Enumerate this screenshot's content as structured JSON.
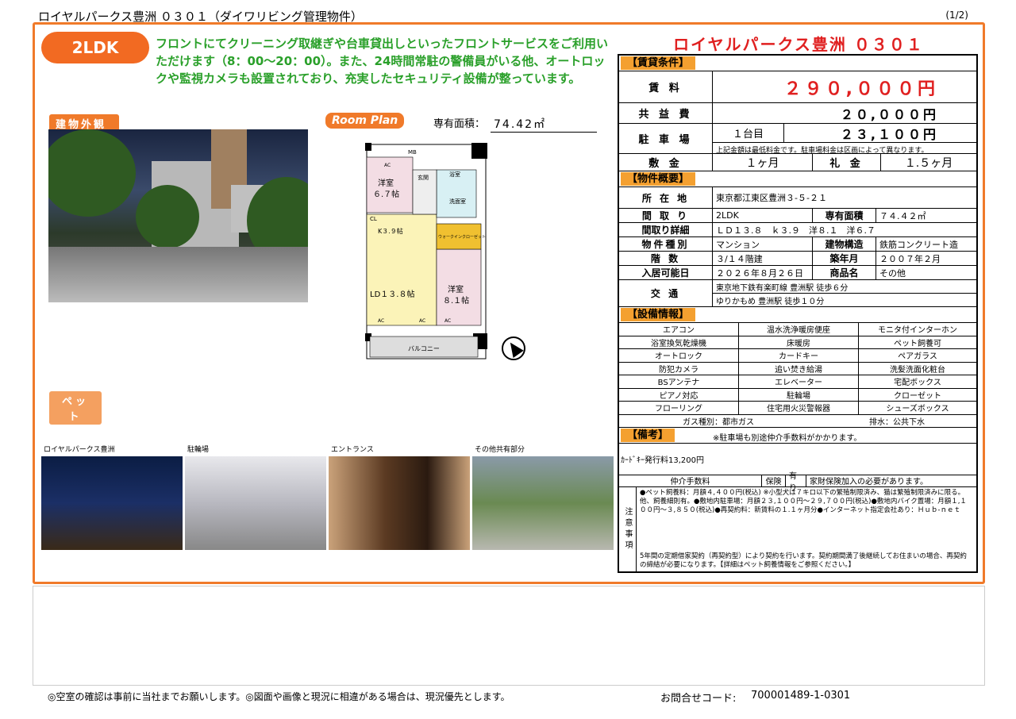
{
  "header": {
    "title": "ロイヤルパークス豊洲 ０３０１（ダイワリビング管理物件）",
    "page": "(1/2)"
  },
  "badge": "2LDK",
  "catchcopy": "フロントにてクリーニング取継ぎや台車貸出しといったフロントサービスをご利用いただけます（8：00〜20：00）。また、24時間常駐の警備員がいる他、オートロックや監視カメラも設置されており、充実したセキュリティ設備が整っています。",
  "labels": {
    "exterior": "建物外観",
    "room_plan": "Room Plan",
    "area_label": "専有面積：",
    "area_value": "74.42㎡",
    "pet": "ペット"
  },
  "floorplan": {
    "western1": "洋室",
    "western1_size": "６.７帖",
    "kitchen": "K３.９帖",
    "ld": "LD１３.８帖",
    "western2": "洋室",
    "western2_size": "８.１帖",
    "entrance": "玄関",
    "bath": "浴室",
    "washroom": "洗面室",
    "walkin": "ウォークインクローゼット",
    "balcony": "バルコニー",
    "mb": "MB",
    "cl": "CL",
    "ac": "AC"
  },
  "thumbnails": [
    {
      "label": "ロイヤルパークス豊洲"
    },
    {
      "label": "駐輪場"
    },
    {
      "label": "エントランス"
    },
    {
      "label": "その他共有部分"
    }
  ],
  "property_title": "ロイヤルパークス豊洲 ０３０１",
  "conditions": {
    "section": "【賃貸条件】",
    "rent_label": "賃 料",
    "rent": "２９０,０００円",
    "common_label": "共 益 費",
    "common": "２０,０００円",
    "parking_label": "駐 車 場",
    "parking_unit": "１台目",
    "parking": "２３,１００円",
    "parking_note": "上記金額は最低料金です。駐車場料金は区画によって異なります。",
    "deposit_label": "敷 金",
    "deposit": "１ヶ月",
    "key_label": "礼 金",
    "key": "１.５ヶ月"
  },
  "overview": {
    "section": "【物件概要】",
    "address_label": "所 在 地",
    "address": "東京都江東区豊洲３-５-２１",
    "layout_label": "間 取 り",
    "layout": "2LDK",
    "area_label": "専有面積",
    "area": "７４.４２㎡",
    "layout_detail_label": "間取り詳細",
    "layout_detail": "ＬＤ１３.８　ｋ３.９　洋８.１　洋６.７",
    "type_label": "物件種別",
    "type": "マンション",
    "structure_label": "建物構造",
    "structure": "鉄筋コンクリート造",
    "floor_label": "階 数",
    "floor": "３/１４階建",
    "built_label": "築年月",
    "built": "２００７年２月",
    "move_label": "入居可能日",
    "move": "２０２６年８月２６日",
    "product_label": "商品名",
    "product": "その他",
    "access_label": "交 通",
    "access1": "東京地下鉄有楽町線 豊洲駅 徒歩６分",
    "access2": "ゆりかもめ 豊洲駅 徒歩１０分"
  },
  "facilities": {
    "section": "【設備情報】",
    "items": [
      "エアコン",
      "温水洗浄暖房便座",
      "モニタ付インターホン",
      "浴室換気乾燥機",
      "床暖房",
      "ペット飼養可",
      "オートロック",
      "カードキー",
      "ペアガラス",
      "防犯カメラ",
      "追い焚き給湯",
      "洗髪洗面化粧台",
      "BSアンテナ",
      "エレベーター",
      "宅配ボックス",
      "ピアノ対応",
      "駐輪場",
      "クローゼット",
      "フローリング",
      "住宅用火災警報器",
      "シューズボックス"
    ],
    "gas": "ガス種別：都市ガス",
    "drain": "排水：公共下水"
  },
  "remarks": {
    "section": "【備考】",
    "notice": "※駐車場も別途仲介手数料がかかります。",
    "card_key": "ｶｰﾄﾞｷｰ発行料13,200円",
    "broker_label": "仲介手数料",
    "insurance_label": "保険",
    "insurance_value": "有り",
    "insurance_note": "家財保険加入の必要があります。",
    "caution_label": "注意事項",
    "caution1": "●ペット飼養料：月額４,４００円(税込) ※小型犬は７キロ以下の繁殖制限済み、猫は繁殖制限済みに限る。他、飼養細則有。●敷地内駐車場：月額２３,１００円〜２９,７００円(税込)●敷地内バイク置場：月額１,１００円〜３,８５０(税込)●再契約料：新賃料の１.１ヶ月分●インターネット指定会社あり：Ｈｕｂ-ｎｅｔ",
    "caution2": "5年間の定期借家契約（再契約型）により契約を行います。契約期間満了後継続してお住まいの場合、再契約の締結が必要になります。【詳細はペット飼養情報をご参照ください。】"
  },
  "footer": {
    "notice": "◎空室の確認は事前に当社までお願いします。◎図面や画像と現況に相違がある場合は、現況優先とします。",
    "code_label": "お問合せコード:",
    "code": "700001489-1-0301"
  }
}
